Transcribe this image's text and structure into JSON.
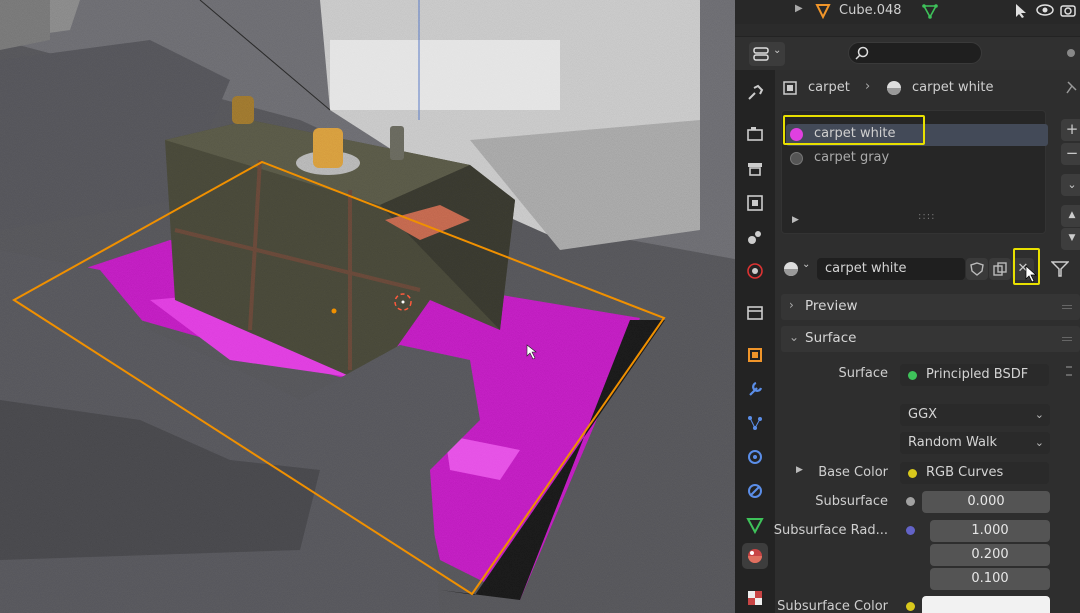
{
  "outliner": {
    "object_name": "Cube.048"
  },
  "header": {
    "search_placeholder": ""
  },
  "breadcrumb": {
    "object": "carpet",
    "material": "carpet white"
  },
  "material_slots": [
    {
      "name": "carpet white",
      "color": "#e040e0",
      "selected": true
    },
    {
      "name": "carpet gray",
      "color": "#555555",
      "selected": false
    }
  ],
  "material_selector": {
    "name": "carpet white"
  },
  "sections": {
    "preview": "Preview",
    "surface": "Surface"
  },
  "surface": {
    "surface_label": "Surface",
    "surface_value": "Principled BSDF",
    "distribution": "GGX",
    "subsurface_method": "Random Walk",
    "base_color_label": "Base Color",
    "base_color_value": "RGB Curves",
    "subsurface_label": "Subsurface",
    "subsurface_value": "0.000",
    "subsurface_radius_label": "Subsurface Rad...",
    "subsurface_radius": [
      "1.000",
      "0.200",
      "0.100"
    ],
    "subsurface_color_label": "Subsurface Color"
  },
  "colors": {
    "highlight": "#e8e000",
    "accent_selection": "#f09000",
    "socket_shader": "#3ec25a",
    "socket_color": "#d8c81c",
    "socket_float": "#a1a1a1",
    "socket_vector": "#6363c7"
  }
}
